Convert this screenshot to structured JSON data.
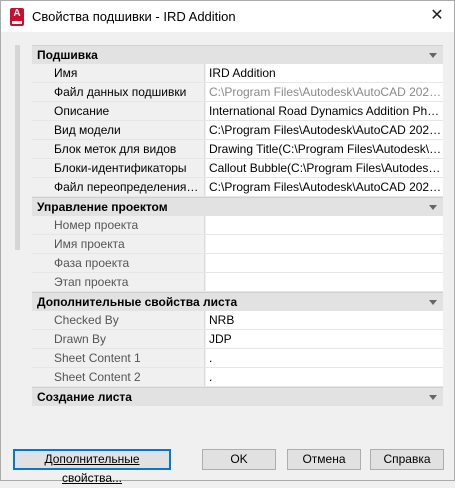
{
  "window": {
    "title": "Свойства подшивки - IRD Addition",
    "app_icon": "autocad-icon",
    "app_icon_glyph": "A",
    "close_glyph": "✕"
  },
  "sections": [
    {
      "title": "Подшивка",
      "rows": [
        {
          "name": "Имя",
          "value": "IRD Addition",
          "value_greyed": false
        },
        {
          "name": "Файл данных подшивки",
          "value": "C:\\Program Files\\Autodesk\\AutoCAD 202…",
          "value_greyed": true
        },
        {
          "name": "Описание",
          "value": "International Road Dynamics Addition Pha…",
          "value_greyed": false
        },
        {
          "name": "Вид модели",
          "value": "C:\\Program Files\\Autodesk\\AutoCAD 202…",
          "value_greyed": false
        },
        {
          "name": "Блок меток для видов",
          "value": "Drawing Title(C:\\Program Files\\Autodesk\\…",
          "value_greyed": false
        },
        {
          "name": "Блоки-идентификаторы",
          "value": "Callout Bubble(C:\\Program Files\\Autodes…",
          "value_greyed": false
        },
        {
          "name": "Файл  переопределения…",
          "value": "C:\\Program Files\\Autodesk\\AutoCAD 202…",
          "value_greyed": false
        }
      ]
    },
    {
      "title": "Управление проектом",
      "rows": [
        {
          "name": "Номер проекта",
          "value": ""
        },
        {
          "name": "Имя проекта",
          "value": ""
        },
        {
          "name": "Фаза проекта",
          "value": ""
        },
        {
          "name": "Этап проекта",
          "value": ""
        }
      ]
    },
    {
      "title": "Дополнительные свойства листа",
      "rows": [
        {
          "name": "Checked By",
          "value": "NRB"
        },
        {
          "name": "Drawn By",
          "value": "JDP"
        },
        {
          "name": "Sheet Content 1",
          "value": "."
        },
        {
          "name": "Sheet Content 2",
          "value": "."
        }
      ]
    },
    {
      "title": "Создание листа",
      "rows": []
    }
  ],
  "buttons": {
    "more": "Дополнительные свойства...",
    "ok": "OK",
    "cancel": "Отмена",
    "help": "Справка"
  }
}
